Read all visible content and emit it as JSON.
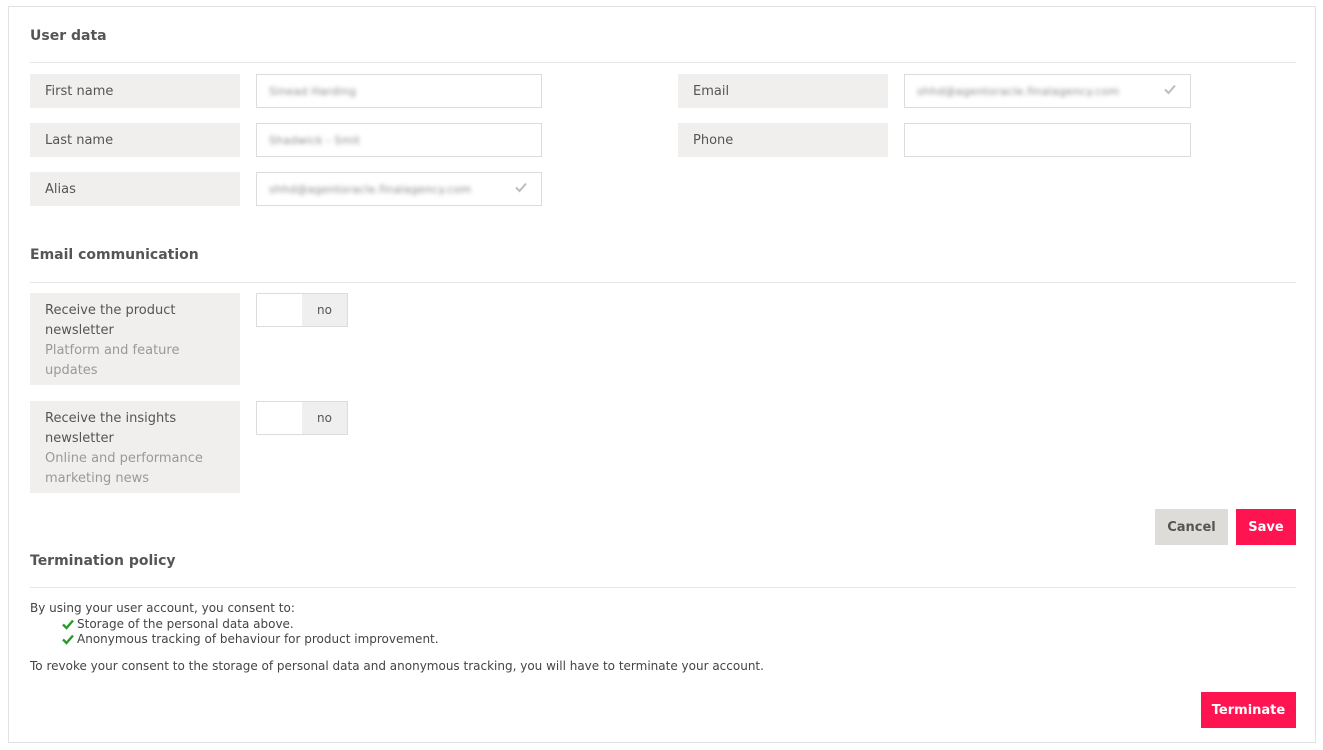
{
  "user_data": {
    "title": "User data",
    "first_name": {
      "label": "First name",
      "value": "Sinead Harding"
    },
    "last_name": {
      "label": "Last name",
      "value": "Shadwick - Smit"
    },
    "alias": {
      "label": "Alias",
      "value": "shhd@agentoracle.finalagency.com"
    },
    "email": {
      "label": "Email",
      "value": "shhd@agentoracle.finalagency.com"
    },
    "phone": {
      "label": "Phone",
      "value": ""
    }
  },
  "email_communication": {
    "title": "Email communication",
    "product_newsletter": {
      "title": "Receive the product newsletter",
      "subtitle": "Platform and feature updates",
      "state": "no"
    },
    "insights_newsletter": {
      "title": "Receive the insights newsletter",
      "subtitle": "Online and performance marketing news",
      "state": "no"
    }
  },
  "actions": {
    "cancel": "Cancel",
    "save": "Save",
    "terminate": "Terminate"
  },
  "termination": {
    "title": "Termination policy",
    "intro": "By using your user account, you consent to:",
    "items": [
      "Storage of the personal data above.",
      "Anonymous tracking of behaviour for product improvement."
    ],
    "revoke": "To revoke your consent to the storage of personal data and anonymous tracking, you will have to terminate your account."
  },
  "colors": {
    "accent": "#ff1452",
    "check_green": "#2a9a2a"
  },
  "icons": {
    "verified": "check-icon"
  }
}
